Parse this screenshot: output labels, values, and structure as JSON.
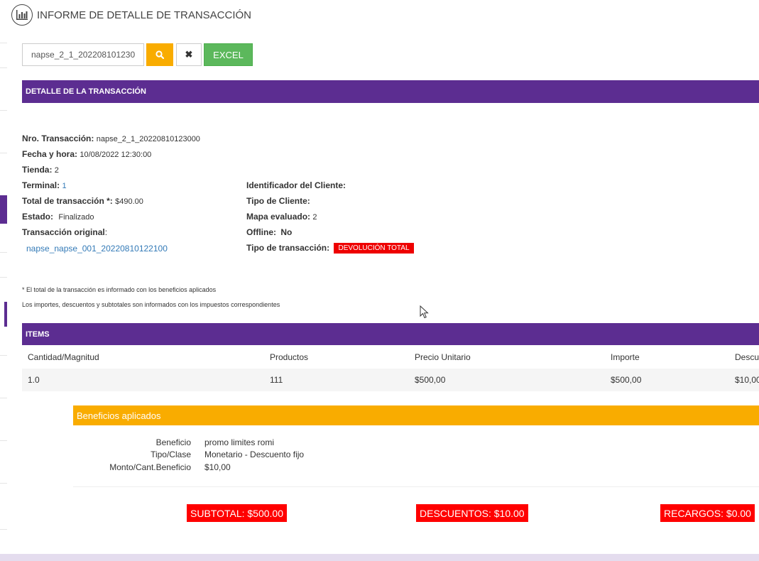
{
  "header": {
    "title": "INFORME DE DETALLE DE TRANSACCIÓN",
    "icon": "bar-chart-icon"
  },
  "search": {
    "value": "napse_2_1_20220810123000",
    "search_icon": "search-icon",
    "clear_icon": "close-icon",
    "excel_label": "EXCEL"
  },
  "detail": {
    "section_title": "DETALLE DE LA TRANSACCIÓN",
    "nro_label": "Nro. Transacción:",
    "nro_value": "napse_2_1_20220810123000",
    "fecha_label": "Fecha y hora:",
    "fecha_value": "10/08/2022 12:30:00",
    "tienda_label": "Tienda:",
    "tienda_value": "2",
    "terminal_label": "Terminal:",
    "terminal_value": "1",
    "total_label": "Total de transacción *:",
    "total_value": "$490.00",
    "estado_label": "Estado:",
    "estado_value": "Finalizado",
    "original_label": "Transacción original",
    "original_colon": ":",
    "original_value": "napse_napse_001_20220810122100",
    "cliente_id_label": "Identificador del Cliente:",
    "cliente_tipo_label": "Tipo de Cliente:",
    "mapa_label": "Mapa evaluado:",
    "mapa_value": "2",
    "offline_label": "Offline:",
    "offline_value": "No",
    "tipo_trx_label": "Tipo de transacción:",
    "tipo_trx_value": "DEVOLUCIÓN TOTAL"
  },
  "notes": {
    "note1": "* El total de la transacción es informado con los beneficios aplicados",
    "note2": "Los importes, descuentos y subtotales son informados con los impuestos correspondientes"
  },
  "items": {
    "section_title": "ITEMS",
    "columns": [
      "Cantidad/Magnitud",
      "Productos",
      "Precio Unitario",
      "Importe",
      "Descu"
    ],
    "rows": [
      [
        "1.0",
        "111",
        "$500,00",
        "$500,00",
        "$10,00"
      ]
    ]
  },
  "benefits": {
    "title": "Beneficios aplicados",
    "beneficio_label": "Beneficio",
    "beneficio_value": "promo limites romi",
    "tipo_label": "Tipo/Clase",
    "tipo_value": "Monetario - Descuento fijo",
    "monto_label": "Monto/Cant.Beneficio",
    "monto_value": "$10,00"
  },
  "totals": {
    "subtotal": "SUBTOTAL: $500.00",
    "descuentos": "DESCUENTOS: $10.00",
    "recargos": "RECARGOS: $0.00"
  },
  "colors": {
    "purple": "#5c2d91",
    "orange": "#f9ac00",
    "green": "#5cb85c",
    "red": "#ff0000",
    "link": "#337ab7"
  }
}
